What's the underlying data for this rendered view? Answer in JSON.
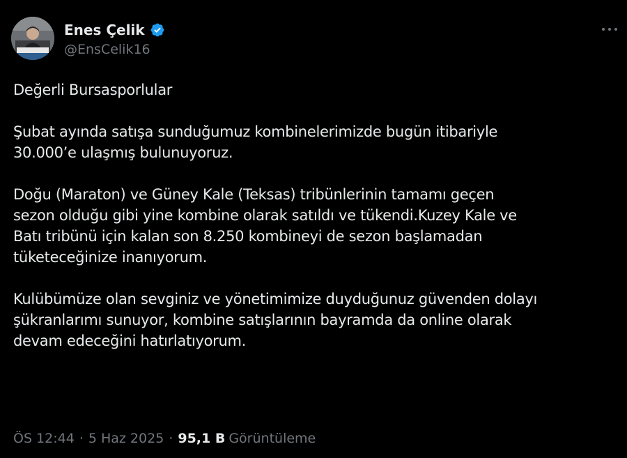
{
  "author": {
    "display_name": "Enes Çelik",
    "handle": "@EnsCelik16",
    "verified": true,
    "verified_color": "#1d9bf0"
  },
  "tweet": {
    "paragraphs": [
      "Değerli Bursasporlular",
      "Şubat ayında satışa sunduğumuz kombinelerimizde bugün itibariyle\n30.000’e ulaşmış bulunuyoruz.",
      "Doğu (Maraton) ve Güney Kale (Teksas) tribünlerinin tamamı geçen\nsezon olduğu gibi yine kombine olarak satıldı ve tükendi.Kuzey Kale ve\nBatı tribünü için kalan son 8.250 kombineyi de sezon başlamadan\ntüketeceğinize inanıyorum.",
      "Kulübümüze olan sevginiz ve yönetimimize duyduğunuz güvenden dolayı\nşükranlarımı sunuyor, kombine satışlarının bayramda da online olarak\ndevam edeceğini hatırlatıyorum."
    ]
  },
  "meta": {
    "time": "ÖS 12:44",
    "separator": "·",
    "date": "5 Haz 2025",
    "views_count": "95,1 B",
    "views_label": "Görüntüleme"
  },
  "icons": {
    "more": "more-horizontal-icon",
    "verified": "verified-badge-icon"
  },
  "colors": {
    "background": "#000000",
    "text_primary": "#e7e9ea",
    "text_secondary": "#71767b"
  }
}
